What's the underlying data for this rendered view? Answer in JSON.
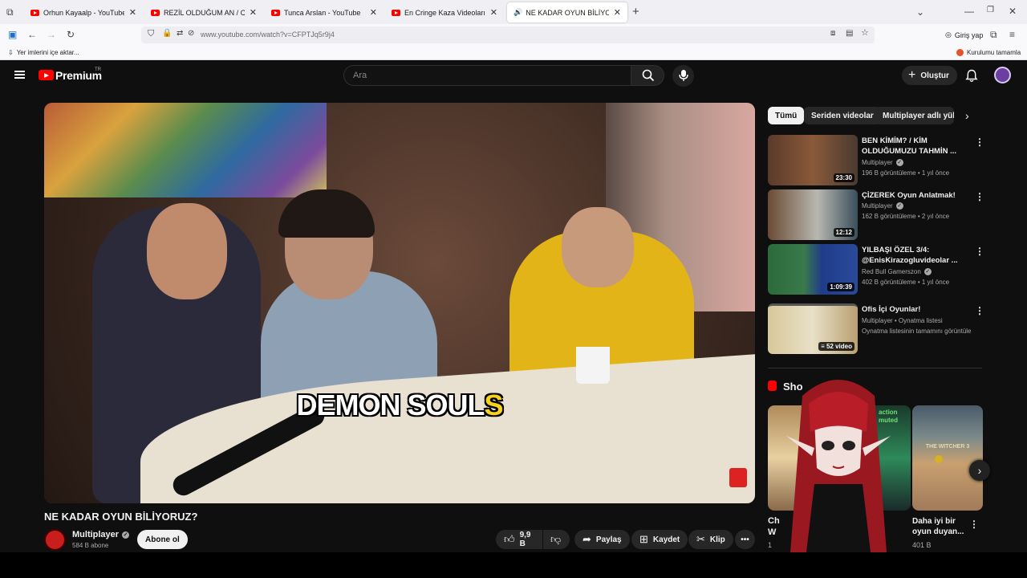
{
  "browser": {
    "tabs": [
      {
        "title": "Orhun Kayaalp - YouTube"
      },
      {
        "title": "REZİL OLDUĞUM AN / CNN MA"
      },
      {
        "title": "Tunca Arslan - YouTube"
      },
      {
        "title": "En Cringe Kaza Videoları! @csn"
      },
      {
        "title": "NE KADAR OYUN BİLİYORU"
      }
    ],
    "url": "www.youtube.com/watch?v=CFPTJq5r9j4",
    "login_label": "Giriş yap",
    "bookmarks_import": "Yer imlerini içe aktar...",
    "setup_label": "Kurulumu tamamla"
  },
  "youtube": {
    "logo_text": "Premium",
    "logo_region": "TR",
    "search_placeholder": "Ara",
    "create_label": "Oluştur",
    "video": {
      "subtitle_main": "DEMON SOUL",
      "subtitle_highlight": "S",
      "title": "NE KADAR OYUN BİLİYORUZ?",
      "channel": "Multiplayer",
      "subscribers": "584 B abone",
      "subscribe_label": "Abone ol",
      "likes": "9,9 B",
      "share_label": "Paylaş",
      "save_label": "Kaydet",
      "clip_label": "Klip"
    },
    "chips": [
      {
        "label": "Tümü"
      },
      {
        "label": "Seriden videolar"
      },
      {
        "label": "Multiplayer adlı yükleyicinin"
      }
    ],
    "recommended": [
      {
        "title": "BEN KİMİM? / KİM OLDUĞUMUZU TAHMİN ...",
        "channel": "Multiplayer",
        "meta": "196 B görüntüleme • 1 yıl önce",
        "duration": "23:30"
      },
      {
        "title": "ÇİZEREK Oyun Anlatmak!",
        "channel": "Multiplayer",
        "meta": "162 B görüntüleme • 2 yıl önce",
        "duration": "12:12"
      },
      {
        "title": "YILBAŞI ÖZEL 3/4: @EnisKirazogluvideolar ...",
        "channel": "Red Bull Gamerszon",
        "meta": "402 B görüntüleme • 1 yıl önce",
        "duration": "1:09:39"
      },
      {
        "title": "Ofis İçi Oyunlar!",
        "channel": "Multiplayer • Oynatma listesi",
        "meta": "Oynatma listesinin tamamını görüntüle",
        "duration": "52 video"
      }
    ],
    "shorts": {
      "heading": "Sho",
      "items": [
        {
          "title": "Ch",
          "subtitle": "W",
          "views": "1"
        },
        {
          "title": "action muted",
          "subtitle": "",
          "views": ""
        },
        {
          "title": "Daha iyi bir oyun duyan...",
          "views": "401 B",
          "overlay": "THE WITCHER 3"
        }
      ]
    }
  }
}
